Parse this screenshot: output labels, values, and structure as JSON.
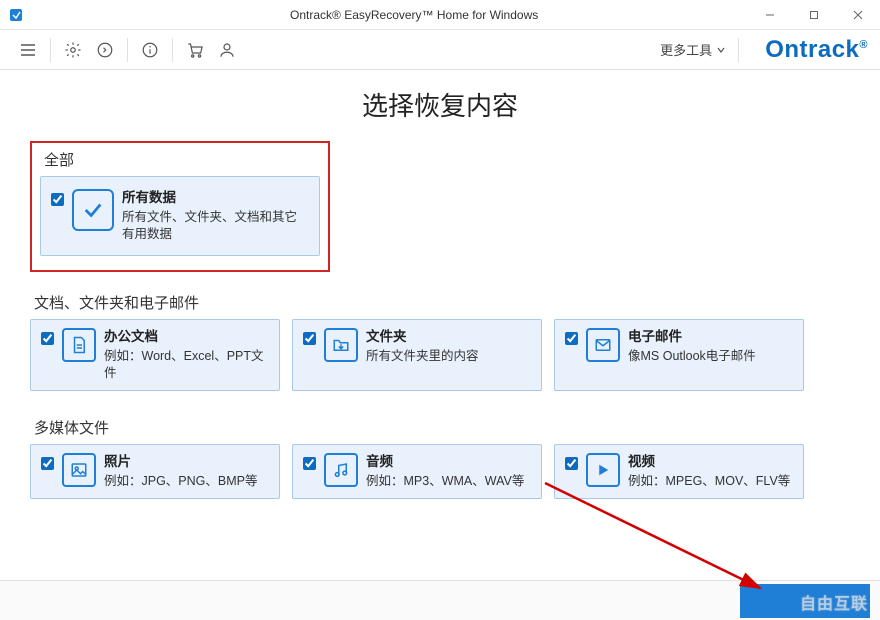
{
  "window": {
    "title": "Ontrack® EasyRecovery™ Home for Windows"
  },
  "toolbar": {
    "more_tools_label": "更多工具",
    "brand": "Ontrack"
  },
  "page": {
    "title": "选择恢复内容",
    "sections": {
      "all": {
        "title": "全部",
        "card": {
          "title": "所有数据",
          "desc": "所有文件、文件夹、文档和其它有用数据"
        }
      },
      "docs": {
        "title": "文档、文件夹和电子邮件",
        "cards": [
          {
            "title": "办公文档",
            "desc": "例如：Word、Excel、PPT文件"
          },
          {
            "title": "文件夹",
            "desc": "所有文件夹里的内容"
          },
          {
            "title": "电子邮件",
            "desc": "像MS Outlook电子邮件"
          }
        ]
      },
      "media": {
        "title": "多媒体文件",
        "cards": [
          {
            "title": "照片",
            "desc": "例如：JPG、PNG、BMP等"
          },
          {
            "title": "音频",
            "desc": "例如：MP3、WMA、WAV等"
          },
          {
            "title": "视频",
            "desc": "例如：MPEG、MOV、FLV等"
          }
        ]
      }
    }
  },
  "watermark": "自由互联"
}
